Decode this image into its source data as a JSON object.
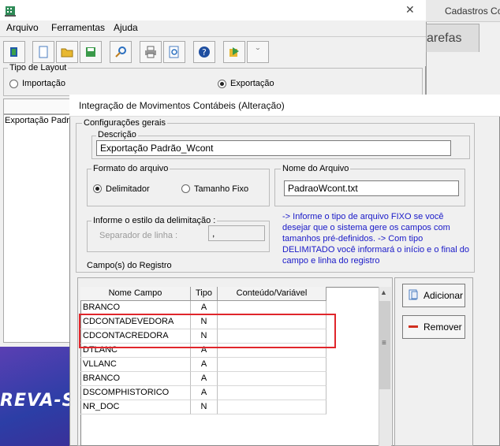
{
  "main_window": {
    "menu": [
      "Arquivo",
      "Ferramentas",
      "Ajuda"
    ],
    "layout_group": {
      "legend": "Tipo de Layout",
      "options": [
        {
          "label": "Importação",
          "selected": false
        },
        {
          "label": "Exportação",
          "selected": true
        }
      ]
    },
    "list_item": "Exportação Padrã"
  },
  "background_app": {
    "title": "Cadastros Co",
    "tab": "arefas",
    "brand": "REVA-SE"
  },
  "dialog": {
    "title": "Integração de Movimentos Contábeis (Alteração)",
    "general_legend": "Configurações gerais",
    "description_legend": "Descrição",
    "description_value": "Exportação Padrão_Wcont",
    "format_legend": "Formato do arquivo",
    "format_options": [
      {
        "label": "Delimitador",
        "selected": true
      },
      {
        "label": "Tamanho Fixo",
        "selected": false
      }
    ],
    "filename_legend": "Nome do Arquivo",
    "filename_value": "PadraoWcont.txt",
    "delim_legend": "Informe o estilo da delimitação :",
    "line_sep_label": "Separador de linha :",
    "line_sep_value": ",",
    "info": "-> Informe o tipo de arquivo FIXO se você desejar que o sistema gere os campos com tamanhos pré-definidos. -> Com tipo DELIMITADO você informará o início e o final do campo e linha do registro",
    "fields_label": "Campo(s) do Registro",
    "grid": {
      "columns": [
        "Nome Campo",
        "Tipo",
        "Conteúdo/Variável"
      ],
      "rows": [
        [
          "BRANCO",
          "A",
          ""
        ],
        [
          "CDCONTADEVEDORA",
          "N",
          ""
        ],
        [
          "CDCONTACREDORA",
          "N",
          ""
        ],
        [
          "DTLANC",
          "A",
          ""
        ],
        [
          "VLLANC",
          "A",
          ""
        ],
        [
          "BRANCO",
          "A",
          ""
        ],
        [
          "DSCOMPHISTORICO",
          "A",
          ""
        ],
        [
          "NR_DOC",
          "N",
          ""
        ]
      ]
    },
    "buttons": {
      "add": "Adicionar",
      "remove": "Remover"
    }
  },
  "colors": {
    "highlight": "#e0262b",
    "info_text": "#1919c8"
  }
}
